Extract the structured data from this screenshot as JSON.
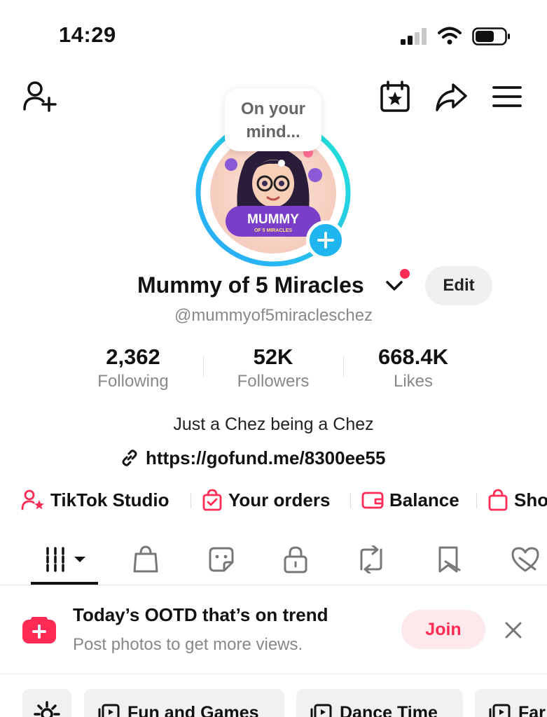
{
  "status_bar": {
    "time": "14:29"
  },
  "profile": {
    "bubble_text_line1": "On your",
    "bubble_text_line2": "mind...",
    "avatar_text": "MUMMY",
    "avatar_subtext": "OF 5 MIRACLES",
    "name": "Mummy of 5 Miracles",
    "edit_label": "Edit",
    "handle": "@mummyof5miracleschez",
    "bio": "Just a Chez being a Chez",
    "link": "https://gofund.me/8300ee55"
  },
  "stats": [
    {
      "value": "2,362",
      "label": "Following"
    },
    {
      "value": "52K",
      "label": "Followers"
    },
    {
      "value": "668.4K",
      "label": "Likes"
    }
  ],
  "shortcuts": [
    {
      "label": "TikTok Studio",
      "icon": "person-star-icon"
    },
    {
      "label": "Your orders",
      "icon": "shopping-bag-check-icon"
    },
    {
      "label": "Balance",
      "icon": "wallet-icon"
    },
    {
      "label": "Sho",
      "icon": "shop-bag-icon"
    }
  ],
  "tabs": [
    {
      "name": "videos-grid",
      "icon": "grid-icon"
    },
    {
      "name": "shop",
      "icon": "bag-icon"
    },
    {
      "name": "stickers",
      "icon": "sticker-icon"
    },
    {
      "name": "private",
      "icon": "lock-icon"
    },
    {
      "name": "reposts",
      "icon": "repost-icon"
    },
    {
      "name": "favorites",
      "icon": "bookmark-icon"
    },
    {
      "name": "liked",
      "icon": "heart-hidden-icon"
    }
  ],
  "banner": {
    "title": "Today’s OOTD that’s on trend",
    "subtitle": "Post photos to get more views.",
    "join_label": "Join"
  },
  "playlists": [
    {
      "label": "Fun and Games"
    },
    {
      "label": "Dance Time"
    },
    {
      "label": "Far"
    }
  ],
  "colors": {
    "accent_red": "#fe2c55",
    "accent_blue": "#1fb6f0",
    "text_primary": "#111111",
    "text_secondary": "#888888"
  }
}
